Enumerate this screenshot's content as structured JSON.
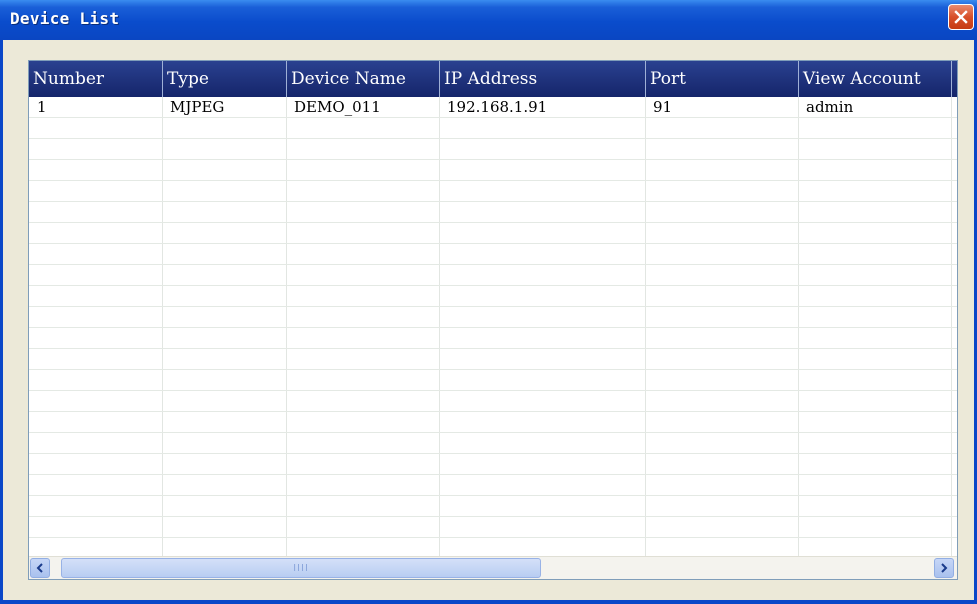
{
  "window": {
    "title": "Device List"
  },
  "table": {
    "columns": [
      "Number",
      "Type",
      "Device Name",
      "IP Address",
      "Port",
      "View Account"
    ],
    "rows": [
      [
        "1",
        "MJPEG",
        "DEMO_011",
        "192.168.1.91",
        "91",
        "admin"
      ]
    ]
  },
  "scrollbar": {
    "grip": "IIII"
  },
  "colors": {
    "titlebar": "#0a4ccc",
    "header": "#1c2f72",
    "close": "#d8502a"
  }
}
